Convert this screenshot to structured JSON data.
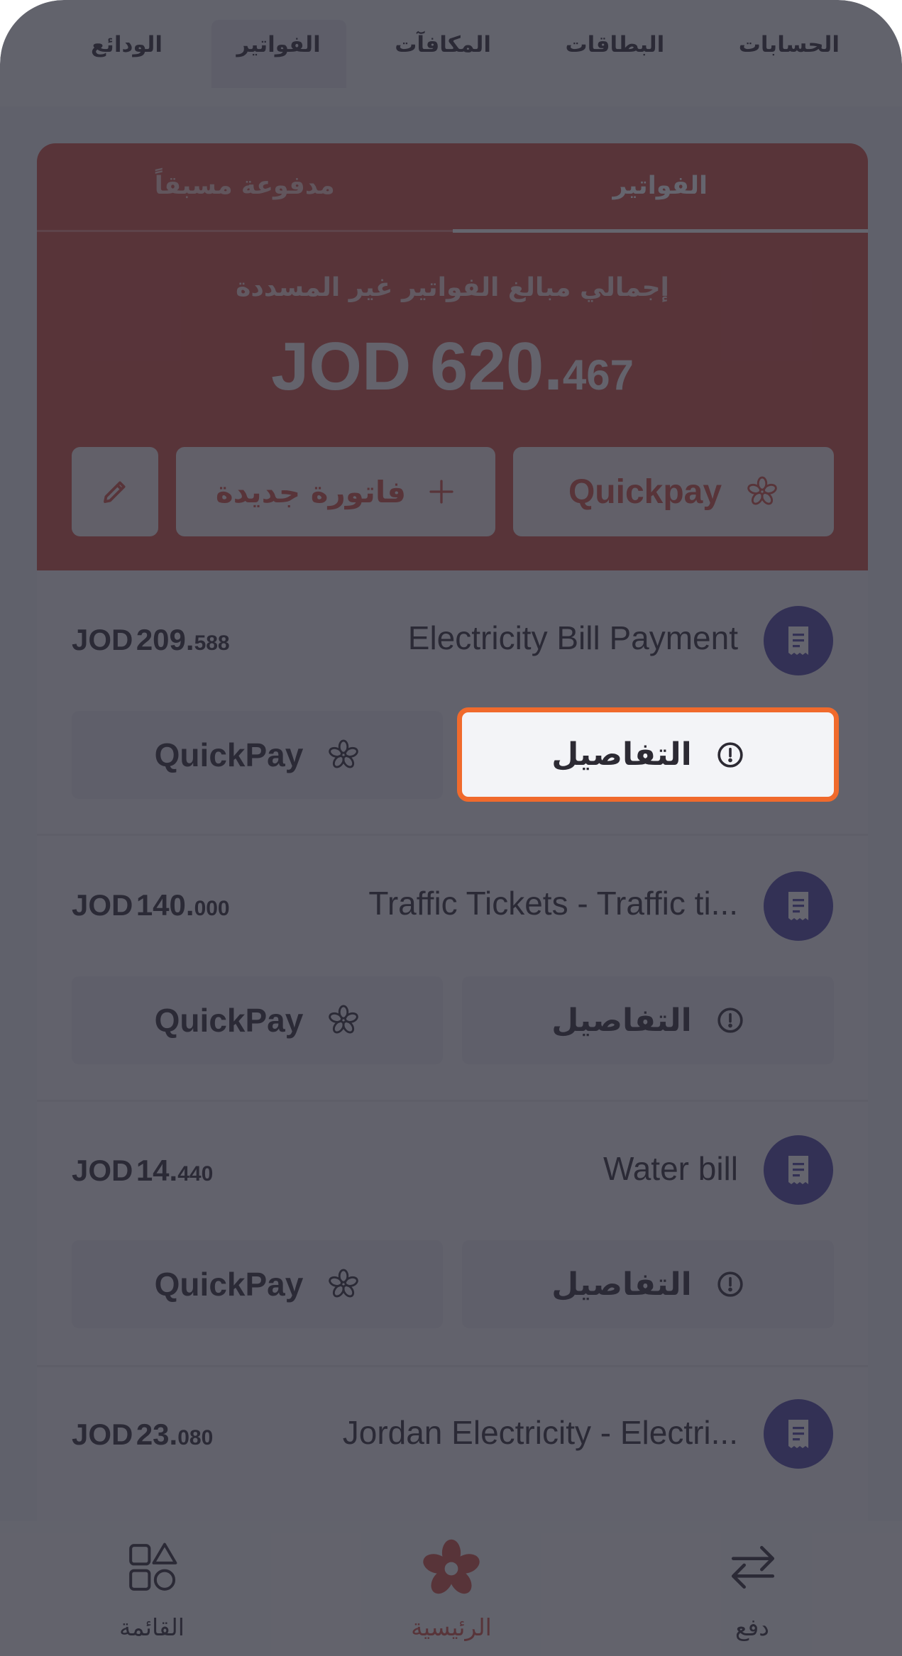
{
  "top_tabs": {
    "items": [
      {
        "label": "الحسابات"
      },
      {
        "label": "البطاقات"
      },
      {
        "label": "المكافآت"
      },
      {
        "label": "الفواتير"
      },
      {
        "label": "الودائع"
      }
    ],
    "active_index": 3
  },
  "bills_card": {
    "tabs": {
      "bills": "الفواتير",
      "prepaid": "مدفوعة مسبقاً"
    },
    "total_label": "إجمالي مبالغ الفواتير غير المسددة",
    "total_amount": {
      "currency": "JOD",
      "major": "620.",
      "minor": "467"
    },
    "quickpay_label": "Quickpay",
    "new_bill_label": "فاتورة جديدة"
  },
  "bills": [
    {
      "name": "Electricity Bill Payment",
      "currency": "JOD",
      "major": "209.",
      "minor": "588",
      "details_label": "التفاصيل",
      "quickpay_label": "QuickPay"
    },
    {
      "name": "Traffic Tickets - Traffic ti...",
      "currency": "JOD",
      "major": "140.",
      "minor": "000",
      "details_label": "التفاصيل",
      "quickpay_label": "QuickPay"
    },
    {
      "name": "Water bill",
      "currency": "JOD",
      "major": "14.",
      "minor": "440",
      "details_label": "التفاصيل",
      "quickpay_label": "QuickPay"
    },
    {
      "name": "Jordan Electricity - Electri...",
      "currency": "JOD",
      "major": "23.",
      "minor": "080"
    }
  ],
  "highlighted_button": {
    "label": "التفاصيل"
  },
  "bottom_nav": {
    "menu": "القائمة",
    "home": "الرئيسية",
    "pay": "دفع"
  },
  "colors": {
    "accent": "#cf4f43",
    "icon_bg": "#4e46a6",
    "highlight_border": "#f06a2c"
  }
}
